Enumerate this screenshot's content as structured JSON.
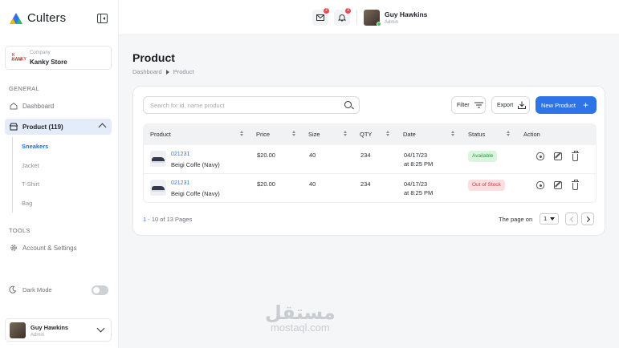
{
  "brand": {
    "name": "Culters"
  },
  "company": {
    "label": "Company",
    "name": "Kanky Store",
    "logo_text_top": "K KANKY",
    "logo_text_bottom": "STORE"
  },
  "sidebar": {
    "general_label": "GENERAL",
    "items": [
      {
        "label": "Dashboard",
        "icon": "home-icon"
      },
      {
        "label": "Product (119)",
        "icon": "store-icon"
      }
    ],
    "sub_items": [
      "Sneakers",
      "Jacket",
      "T-Shirt",
      "Bag"
    ],
    "tools_label": "TOOLS",
    "tools_items": [
      {
        "label": "Account & Settings",
        "icon": "gear-icon"
      }
    ],
    "dark_mode_label": "Dark Mode"
  },
  "user": {
    "name": "Guy Hawkins",
    "role": "Admin"
  },
  "topbar": {
    "mail_badge": "2",
    "bell_badge": "3"
  },
  "page": {
    "title": "Product",
    "breadcrumb": [
      "Dashboard",
      "Product"
    ]
  },
  "toolbar": {
    "search_placeholder": "Search for id, name product",
    "filter_label": "Filter",
    "export_label": "Export",
    "new_product_label": "New Product"
  },
  "table": {
    "columns": [
      "Product",
      "Price",
      "Size",
      "QTY",
      "Date",
      "Status",
      "Action"
    ],
    "rows": [
      {
        "code": "021231",
        "name": "Beigi Coffe (Navy)",
        "price": "$20.00",
        "size": "40",
        "qty": "234",
        "date": "04/17/23",
        "time": "at 8:25 PM",
        "status": "Available"
      },
      {
        "code": "021231",
        "name": "Beigi Coffe (Navy)",
        "price": "$20.00",
        "size": "40",
        "qty": "234",
        "date": "04/17/23",
        "time": "at 8:25 PM",
        "status": "Out of Stock"
      }
    ]
  },
  "pagination": {
    "range_start": "1",
    "range_rest": " - 10 of 13 Pages",
    "page_on_label": "The page on",
    "current_page": "1"
  },
  "watermark": {
    "arabic": "مستقل",
    "latin": "mostaql.com"
  },
  "colors": {
    "accent": "#2f74e6",
    "available": "#2a9a3c",
    "out_of_stock": "#d6373d"
  }
}
